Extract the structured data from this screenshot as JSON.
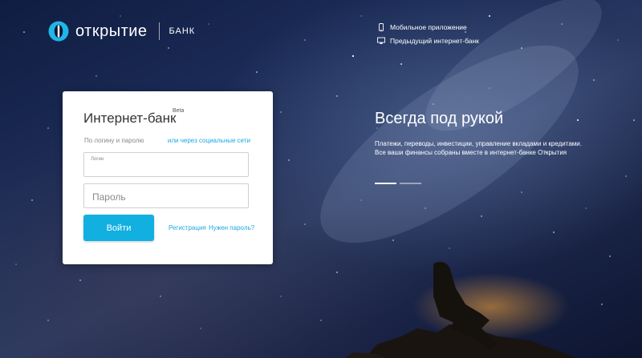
{
  "brand": {
    "logo_text": "открытие",
    "bank_label": "БАНК"
  },
  "top_links": {
    "mobile_app": "Мобильное приложение",
    "prev_bank": "Предыдущий интернет-банк"
  },
  "login_card": {
    "title": "Интернет-банк",
    "beta": "Beta",
    "tab_login": "По логину и паролю",
    "tab_social": "или через социальные сети",
    "login_label": "Логин",
    "password_placeholder": "Пароль",
    "submit_label": "Войти",
    "register_link": "Регистрация",
    "forgot_link": "Нужен пароль?"
  },
  "promo": {
    "title": "Всегда под рукой",
    "text_line1": "Платежи, переводы, инвестиции, управление вкладами и кредитами.",
    "text_line2": "Все ваши финансы собраны вместе в интернет-банке Открытия"
  },
  "colors": {
    "accent": "#11b0e0",
    "link": "#1ca8e3"
  },
  "icons": {
    "logo": "otkritie-logo-icon",
    "mobile": "phone-icon",
    "prev": "monitor-icon"
  },
  "slider": {
    "slides": 2,
    "active": 1
  }
}
